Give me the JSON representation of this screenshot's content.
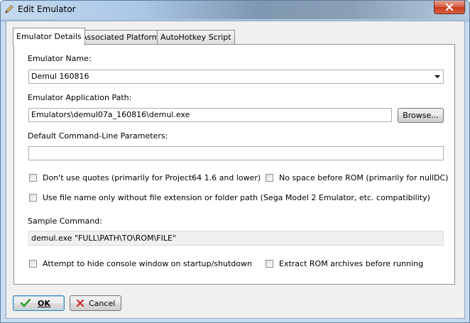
{
  "window": {
    "title": "Edit Emulator"
  },
  "tabs": [
    {
      "label": "Emulator Details",
      "active": true
    },
    {
      "label": "Associated Platforms",
      "active": false
    },
    {
      "label": "AutoHotkey Script",
      "active": false
    }
  ],
  "fields": {
    "name_label": "Emulator Name:",
    "name_value": "Demul 160816",
    "path_label": "Emulator Application Path:",
    "path_value": "Emulators\\demul07a_160816\\demul.exe",
    "browse_label": "Browse...",
    "params_label": "Default Command-Line Parameters:",
    "params_value": "",
    "sample_label": "Sample Command:",
    "sample_value": "demul.exe \"FULL\\PATH\\TO\\ROM\\FILE\""
  },
  "options": {
    "no_quotes": {
      "label": "Don't use quotes (primarily for Project64 1.6 and lower)",
      "checked": false
    },
    "no_space": {
      "label": "No space before ROM (primarily for nullDC)",
      "checked": false
    },
    "filename_only": {
      "label": "Use file name only without file extension or folder path (Sega Model 2 Emulator, etc. compatibility)",
      "checked": false
    },
    "hide_console": {
      "label": "Attempt to hide console window on startup/shutdown",
      "checked": false
    },
    "extract_rom": {
      "label": "Extract ROM archives before running",
      "checked": false
    }
  },
  "buttons": {
    "ok": "OK",
    "cancel": "Cancel"
  },
  "colors": {
    "ok_check": "#2e9b2e",
    "cancel_x": "#cc2b2b",
    "close_button": "#c63a1e"
  },
  "icons": {
    "title": "pencil-icon",
    "close": "close-icon",
    "ok": "checkmark-icon",
    "cancel": "x-icon"
  }
}
